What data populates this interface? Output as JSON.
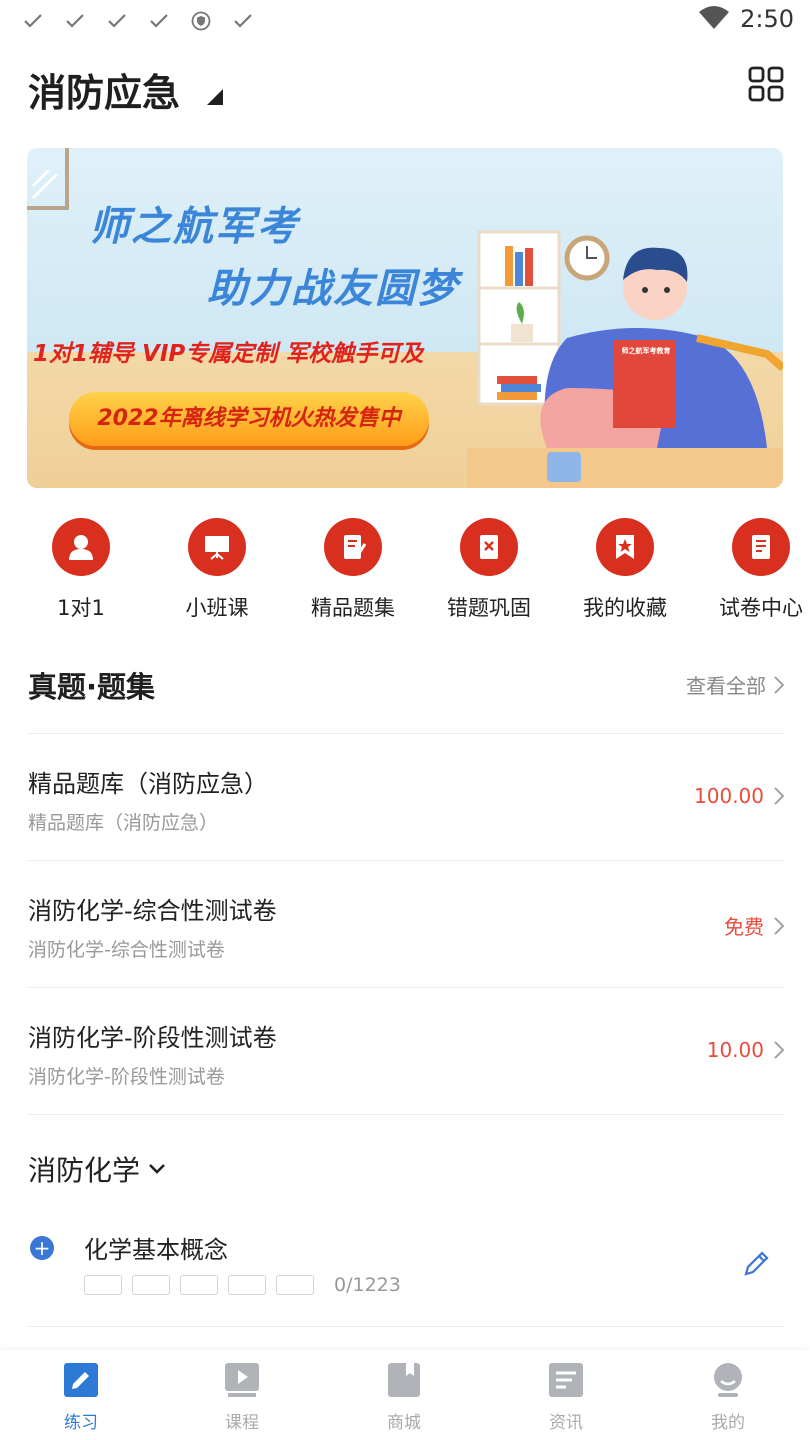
{
  "status_bar": {
    "time": "2:50"
  },
  "header": {
    "title": "消防应急"
  },
  "banner": {
    "line1": "师之航军考",
    "line2": "助力战友圆梦",
    "line3": "1对1辅导  VIP专属定制  军校触手可及",
    "pill": "2022年离线学习机火热发售中",
    "book_label": "师之航军考教育"
  },
  "categories": [
    {
      "label": "1对1",
      "icon": "user-icon"
    },
    {
      "label": "小班课",
      "icon": "presentation-board-icon"
    },
    {
      "label": "精品题集",
      "icon": "notebook-pen-icon"
    },
    {
      "label": "错题巩固",
      "icon": "wrong-paper-icon"
    },
    {
      "label": "我的收藏",
      "icon": "bookmark-star-icon"
    },
    {
      "label": "试卷中心",
      "icon": "paper-icon"
    }
  ],
  "section": {
    "title": "真题·题集",
    "more": "查看全部"
  },
  "items": [
    {
      "title": "精品题库（消防应急）",
      "subtitle": "精品题库（消防应急）",
      "price": "100.00"
    },
    {
      "title": "消防化学-综合性测试卷",
      "subtitle": "消防化学-综合性测试卷",
      "price": "免费"
    },
    {
      "title": "消防化学-阶段性测试卷",
      "subtitle": "消防化学-阶段性测试卷",
      "price": "10.00"
    }
  ],
  "chapter": {
    "title": "消防化学",
    "item_title": "化学基本概念",
    "progress": "0/1223"
  },
  "tabs": [
    {
      "label": "练习",
      "icon": "pencil-icon",
      "active": true
    },
    {
      "label": "课程",
      "icon": "play-icon",
      "active": false
    },
    {
      "label": "商城",
      "icon": "book-icon",
      "active": false
    },
    {
      "label": "资讯",
      "icon": "news-icon",
      "active": false
    },
    {
      "label": "我的",
      "icon": "profile-icon",
      "active": false
    }
  ],
  "colors": {
    "accent": "#2d7ad6",
    "price": "#e74c3c",
    "category": "#d92f1f"
  }
}
